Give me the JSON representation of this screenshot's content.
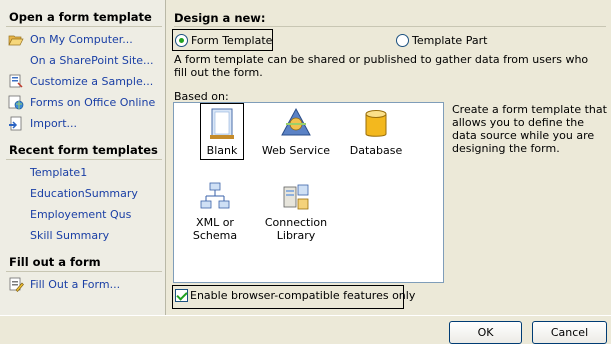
{
  "left_pane": {
    "open_section": {
      "title": "Open a form template",
      "items": [
        {
          "label": "On My Computer...",
          "icon": "folder-open-icon"
        },
        {
          "label": "On a SharePoint Site...",
          "icon": ""
        },
        {
          "label": "Customize a Sample...",
          "icon": "sample-form-icon"
        },
        {
          "label": "Forms on Office Online",
          "icon": "globe-icon"
        },
        {
          "label": "Import...",
          "icon": "import-icon"
        }
      ]
    },
    "recent_section": {
      "title": "Recent form templates",
      "items": [
        "Template1",
        "EducationSummary",
        "Employement Qus",
        "Skill Summary"
      ]
    },
    "fill_section": {
      "title": "Fill out a form",
      "items": [
        {
          "label": "Fill Out a Form...",
          "icon": "fill-form-icon"
        }
      ]
    }
  },
  "design": {
    "title": "Design a new:",
    "options": [
      {
        "label": "Form Template",
        "selected": true
      },
      {
        "label": "Template Part",
        "selected": false
      }
    ],
    "description": "A form template can be shared or published to gather data from users who fill out the form."
  },
  "based_on": {
    "label": "Based on:",
    "items": [
      {
        "label": "Blank",
        "icon": "blank-form-icon",
        "selected": true
      },
      {
        "label": "Web Service",
        "icon": "web-service-icon",
        "selected": false
      },
      {
        "label": "Database",
        "icon": "database-icon",
        "selected": false
      },
      {
        "label": "XML or Schema",
        "icon": "xml-schema-icon",
        "selected": false
      },
      {
        "label": "Connection Library",
        "icon": "connection-library-icon",
        "selected": false
      }
    ],
    "item_description": "Create a form template that allows you to define the data source while you are designing the form."
  },
  "browser_compat": {
    "label": "Enable browser-compatible features only",
    "checked": true
  },
  "buttons": {
    "ok": "OK",
    "cancel": "Cancel"
  },
  "colors": {
    "link": "#1a3fa5",
    "panel_bg": "#eeede4",
    "dialog_bg": "#ece9d8",
    "list_border": "#7f9db9"
  }
}
